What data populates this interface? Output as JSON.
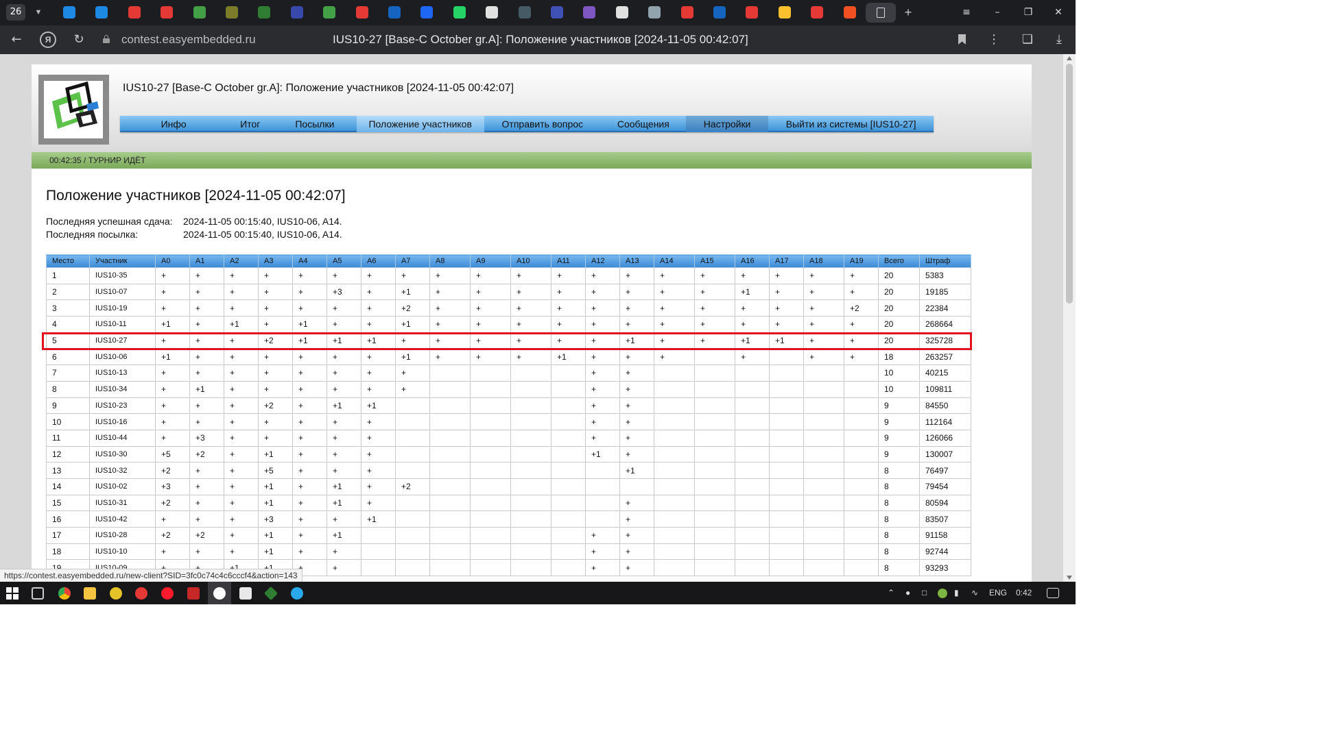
{
  "browser": {
    "tab_count": "26",
    "url_domain": "contest.easyembedded.ru",
    "page_title": "IUS10-27 [Base-C October gr.A]: Положение участников [2024-11-05 00:42:07]",
    "favicon_colors": [
      "#1e88e5",
      "#1e88e5",
      "#e53935",
      "#e53935",
      "#43a047",
      "#7b7b2a",
      "#2e7d32",
      "#3949ab",
      "#43a047",
      "#e53935",
      "#1565c0",
      "#1e66f5",
      "#25d366",
      "#e0e0e0",
      "#455a64",
      "#3f51b5",
      "#7e57c2",
      "#e0e0e0",
      "#90a4ae",
      "#e53935",
      "#1565c0",
      "#e53935",
      "#fbc02d",
      "#e53935",
      "#f25022"
    ]
  },
  "header": {
    "title": "IUS10-27 [Base-C October gr.A]: Положение участников [2024-11-05 00:42:07]"
  },
  "menu": [
    {
      "label": "Инфо"
    },
    {
      "label": "Итог"
    },
    {
      "label": "Посылки"
    },
    {
      "label": "Положение участников"
    },
    {
      "label": "Отправить вопрос"
    },
    {
      "label": "Сообщения"
    },
    {
      "label": "Настройки"
    },
    {
      "label": "Выйти из системы [IUS10-27]"
    }
  ],
  "status": {
    "text": "00:42:35 / ТУРНИР ИДЁТ"
  },
  "main": {
    "title": "Положение участников [2024-11-05 00:42:07]",
    "last_success_label": "Последняя успешная сдача:",
    "last_success_value": "2024-11-05 00:15:40, IUS10-06, A14.",
    "last_submit_label": "Последняя посылка:",
    "last_submit_value": "2024-11-05 00:15:40, IUS10-06, A14."
  },
  "table": {
    "headers": [
      "Место",
      "Участник",
      "A0",
      "A1",
      "A2",
      "A3",
      "A4",
      "A5",
      "A6",
      "A7",
      "A8",
      "A9",
      "A10",
      "A11",
      "A12",
      "A13",
      "A14",
      "A15",
      "A16",
      "A17",
      "A18",
      "A19",
      "Всего",
      "Штраф"
    ],
    "rows": [
      [
        "1",
        "IUS10-35",
        "+",
        "+",
        "+",
        "+",
        "+",
        "+",
        "+",
        "+",
        "+",
        "+",
        "+",
        "+",
        "+",
        "+",
        "+",
        "+",
        "+",
        "+",
        "+",
        "+",
        "20",
        "5383"
      ],
      [
        "2",
        "IUS10-07",
        "+",
        "+",
        "+",
        "+",
        "+",
        "+3",
        "+",
        "+1",
        "+",
        "+",
        "+",
        "+",
        "+",
        "+",
        "+",
        "+",
        "+1",
        "+",
        "+",
        "+",
        "20",
        "19185"
      ],
      [
        "3",
        "IUS10-19",
        "+",
        "+",
        "+",
        "+",
        "+",
        "+",
        "+",
        "+2",
        "+",
        "+",
        "+",
        "+",
        "+",
        "+",
        "+",
        "+",
        "+",
        "+",
        "+",
        "+2",
        "20",
        "22384"
      ],
      [
        "4",
        "IUS10-11",
        "+1",
        "+",
        "+1",
        "+",
        "+1",
        "+",
        "+",
        "+1",
        "+",
        "+",
        "+",
        "+",
        "+",
        "+",
        "+",
        "+",
        "+",
        "+",
        "+",
        "+",
        "20",
        "268664"
      ],
      [
        "5",
        "IUS10-27",
        "+",
        "+",
        "+",
        "+2",
        "+1",
        "+1",
        "+1",
        "+",
        "+",
        "+",
        "+",
        "+",
        "+",
        "+1",
        "+",
        "+",
        "+1",
        "+1",
        "+",
        "+",
        "20",
        "325728"
      ],
      [
        "6",
        "IUS10-06",
        "+1",
        "+",
        "+",
        "+",
        "+",
        "+",
        "+",
        "+1",
        "+",
        "+",
        "+",
        "+1",
        "+",
        "+",
        "+",
        "",
        "+",
        "",
        "+",
        "+",
        "18",
        "263257"
      ],
      [
        "7",
        "IUS10-13",
        "+",
        "+",
        "+",
        "+",
        "+",
        "+",
        "+",
        "+",
        "",
        "",
        "",
        "",
        "+",
        "+",
        "",
        "",
        "",
        "",
        "",
        "",
        "10",
        "40215"
      ],
      [
        "8",
        "IUS10-34",
        "+",
        "+1",
        "+",
        "+",
        "+",
        "+",
        "+",
        "+",
        "",
        "",
        "",
        "",
        "+",
        "+",
        "",
        "",
        "",
        "",
        "",
        "",
        "10",
        "109811"
      ],
      [
        "9",
        "IUS10-23",
        "+",
        "+",
        "+",
        "+2",
        "+",
        "+1",
        "+1",
        "",
        "",
        "",
        "",
        "",
        "+",
        "+",
        "",
        "",
        "",
        "",
        "",
        "",
        "9",
        "84550"
      ],
      [
        "10",
        "IUS10-16",
        "+",
        "+",
        "+",
        "+",
        "+",
        "+",
        "+",
        "",
        "",
        "",
        "",
        "",
        "+",
        "+",
        "",
        "",
        "",
        "",
        "",
        "",
        "9",
        "112164"
      ],
      [
        "11",
        "IUS10-44",
        "+",
        "+3",
        "+",
        "+",
        "+",
        "+",
        "+",
        "",
        "",
        "",
        "",
        "",
        "+",
        "+",
        "",
        "",
        "",
        "",
        "",
        "",
        "9",
        "126066"
      ],
      [
        "12",
        "IUS10-30",
        "+5",
        "+2",
        "+",
        "+1",
        "+",
        "+",
        "+",
        "",
        "",
        "",
        "",
        "",
        "+1",
        "+",
        "",
        "",
        "",
        "",
        "",
        "",
        "9",
        "130007"
      ],
      [
        "13",
        "IUS10-32",
        "+2",
        "+",
        "+",
        "+5",
        "+",
        "+",
        "+",
        "",
        "",
        "",
        "",
        "",
        "",
        "+1",
        "",
        "",
        "",
        "",
        "",
        "",
        "8",
        "76497"
      ],
      [
        "14",
        "IUS10-02",
        "+3",
        "+",
        "+",
        "+1",
        "+",
        "+1",
        "+",
        "+2",
        "",
        "",
        "",
        "",
        "",
        "",
        "",
        "",
        "",
        "",
        "",
        "",
        "8",
        "79454"
      ],
      [
        "15",
        "IUS10-31",
        "+2",
        "+",
        "+",
        "+1",
        "+",
        "+1",
        "+",
        "",
        "",
        "",
        "",
        "",
        "",
        "+",
        "",
        "",
        "",
        "",
        "",
        "",
        "8",
        "80594"
      ],
      [
        "16",
        "IUS10-42",
        "+",
        "+",
        "+",
        "+3",
        "+",
        "+",
        "+1",
        "",
        "",
        "",
        "",
        "",
        "",
        "+",
        "",
        "",
        "",
        "",
        "",
        "",
        "8",
        "83507"
      ],
      [
        "17",
        "IUS10-28",
        "+2",
        "+2",
        "+",
        "+1",
        "+",
        "+1",
        "",
        "",
        "",
        "",
        "",
        "",
        "+",
        "+",
        "",
        "",
        "",
        "",
        "",
        "",
        "8",
        "91158"
      ],
      [
        "18",
        "IUS10-10",
        "+",
        "+",
        "+",
        "+1",
        "+",
        "+",
        "",
        "",
        "",
        "",
        "",
        "",
        "+",
        "+",
        "",
        "",
        "",
        "",
        "",
        "",
        "8",
        "92744"
      ],
      [
        "19",
        "IUS10-09",
        "+",
        "+",
        "+1",
        "+1",
        "+",
        "+",
        "",
        "",
        "",
        "",
        "",
        "",
        "+",
        "+",
        "",
        "",
        "",
        "",
        "",
        "",
        "8",
        "93293"
      ]
    ],
    "highlighted_row": 5
  },
  "hover_link": "https://contest.easyembedded.ru/new-client?SID=3fc0c74c4c6cccf4&action=143",
  "taskbar": {
    "language": "ENG",
    "time": "0:42"
  }
}
